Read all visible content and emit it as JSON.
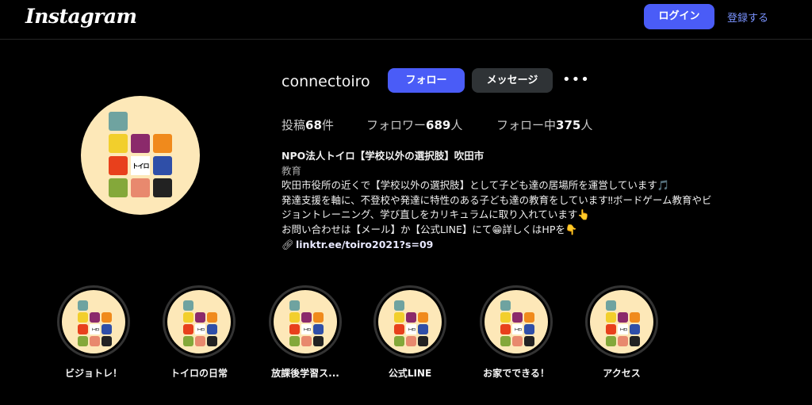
{
  "header": {
    "logo": "Instagram",
    "login_label": "ログイン",
    "signup_label": "登録する"
  },
  "profile": {
    "username": "connectoiro",
    "follow_label": "フォロー",
    "message_label": "メッセージ",
    "more_label": "•••",
    "logo_text": "トイロ",
    "stats": {
      "posts_label": "投稿",
      "posts_count": "68",
      "posts_unit": "件",
      "followers_label": "フォロワー",
      "followers_count": "689",
      "followers_unit": "人",
      "following_label": "フォロー中",
      "following_count": "375",
      "following_unit": "人"
    },
    "bio": {
      "name": "NPO法人トイロ【学校以外の選択肢】吹田市",
      "category": "教育",
      "line1": "吹田市役所の近くで【学校以外の選択肢】として子ども達の居場所を運営しています🎵",
      "line2": "発達支援を軸に、不登校や発達に特性のある子ども達の教育をしています‼ボードゲーム教育やビ",
      "line3": "ジョントレーニング、学び直しをカリキュラムに取り入れています👆",
      "line4": "お問い合わせは【メール】か【公式LINE】にて😁詳しくはHPを👇",
      "link": "linktr.ee/toiro2021?s=09"
    }
  },
  "highlights": [
    {
      "label": "ビジョトレ！"
    },
    {
      "label": "トイロの日常"
    },
    {
      "label": "放課後学習ス..."
    },
    {
      "label": "公式LINE"
    },
    {
      "label": "お家でできる！"
    },
    {
      "label": "アクセス"
    }
  ],
  "colors": {
    "accent": "#4a5cf7",
    "tile_teal": "#6fa3a0",
    "tile_yellow": "#f2cf2c",
    "tile_purple": "#8b2a6b",
    "tile_orange": "#f08a1c",
    "tile_red": "#e8401c",
    "tile_blue": "#2f4fa8",
    "tile_green": "#84a83a",
    "tile_salmon": "#e8896e",
    "tile_black": "#222222"
  }
}
